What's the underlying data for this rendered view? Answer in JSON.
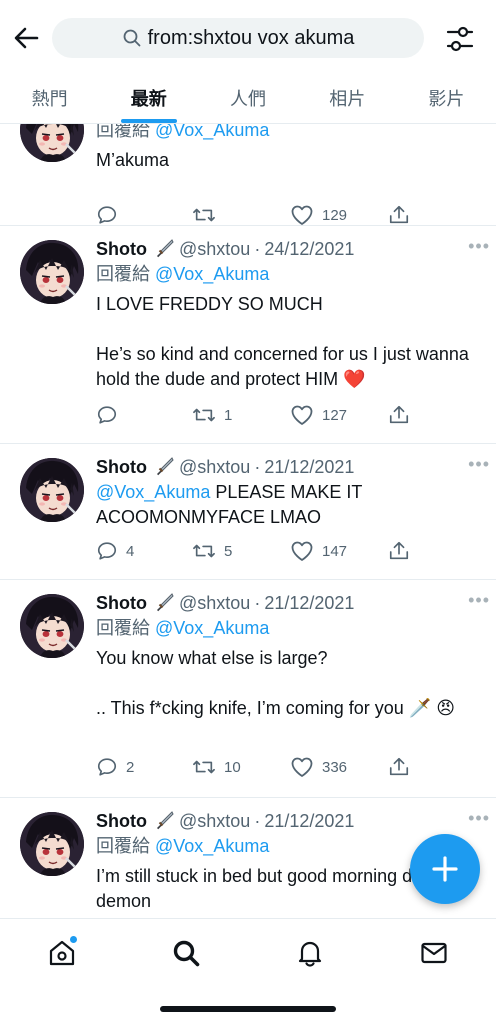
{
  "search": {
    "query": "from:shxtou vox akuma"
  },
  "tabs": [
    {
      "label": "熱門"
    },
    {
      "label": "最新"
    },
    {
      "label": "人們"
    },
    {
      "label": "相片"
    },
    {
      "label": "影片"
    }
  ],
  "accent_color": "#1d9bf0",
  "tweets": [
    {
      "name": "",
      "handle": "",
      "date": "",
      "reply_prefix": "回覆給 ",
      "reply_to": "@Vox_Akuma",
      "text_line1": "M’akuma",
      "replies": "",
      "retweets": "",
      "likes": "129"
    },
    {
      "name": "Shoto",
      "handle": "@shxtou",
      "dot": "·",
      "date": "24/12/2021",
      "reply_prefix": "回覆給 ",
      "reply_to": "@Vox_Akuma",
      "text_line1": "I LOVE FREDDY SO MUCH",
      "text_line2": "He’s so kind and concerned for us I just wanna hold the dude and protect HIM ❤️",
      "replies": "",
      "retweets": "1",
      "likes": "127"
    },
    {
      "name": "Shoto",
      "handle": "@shxtou",
      "dot": "·",
      "date": "21/12/2021",
      "mention": "@Vox_Akuma",
      "text_line1": " PLEASE MAKE IT ACOOMONMYFACE LMAO",
      "replies": "4",
      "retweets": "5",
      "likes": "147"
    },
    {
      "name": "Shoto",
      "handle": "@shxtou",
      "dot": "·",
      "date": "21/12/2021",
      "reply_prefix": "回覆給 ",
      "reply_to": "@Vox_Akuma",
      "text_line1": "You know what else is large?",
      "text_line2": ".. This f*cking knife, I’m coming for you 🗡️ 😠",
      "replies": "2",
      "retweets": "10",
      "likes": "336"
    },
    {
      "name": "Shoto",
      "handle": "@shxtou",
      "dot": "·",
      "date": "21/12/2021",
      "reply_prefix": "回覆給 ",
      "reply_to": "@Vox_Akuma",
      "text_line1": "I’m still stuck in bed but good morning dumb demon"
    }
  ]
}
